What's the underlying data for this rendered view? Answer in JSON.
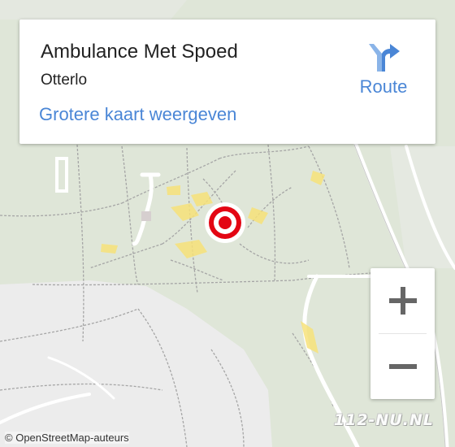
{
  "info_card": {
    "name": "Ambulance Met Spoed",
    "city": "Otterlo",
    "bigger_map_link": "Grotere kaart weergeven",
    "route_label": "Route",
    "route_icon": "route-arrow-icon"
  },
  "map": {
    "marker_icon": "target-marker-icon",
    "colors": {
      "background": "#dfe6d8",
      "open_area": "#eeeeee",
      "forest_path": "#a5a5a5",
      "road": "#ffffff",
      "highlight": "#f7e27a",
      "marker": "#e30613",
      "link": "#4a86d6"
    }
  },
  "zoom": {
    "zoom_in_icon": "plus-icon",
    "zoom_out_icon": "minus-icon"
  },
  "attribution": {
    "symbol": "©",
    "text": "OpenStreetMap-auteurs"
  },
  "watermark": {
    "text": "112-NU.NL"
  }
}
